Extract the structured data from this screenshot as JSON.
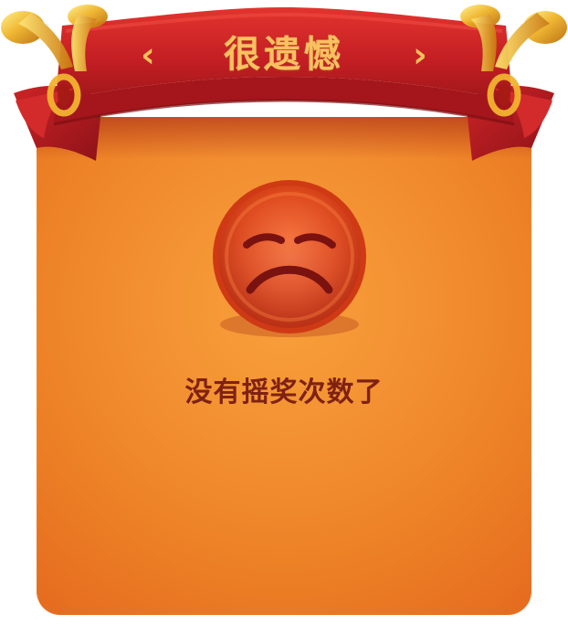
{
  "dialog": {
    "title": "很遗憾",
    "prev_icon": "chevron-left-icon",
    "next_icon": "chevron-right-icon",
    "face_icon": "sad-face-icon",
    "message": "没有摇奖次数了"
  },
  "colors": {
    "panel_orange": "#ef8428",
    "ribbon_red": "#c92423",
    "gold": "#f4bb3a",
    "text_brown": "#7f2112",
    "face_red": "#dc4317"
  }
}
